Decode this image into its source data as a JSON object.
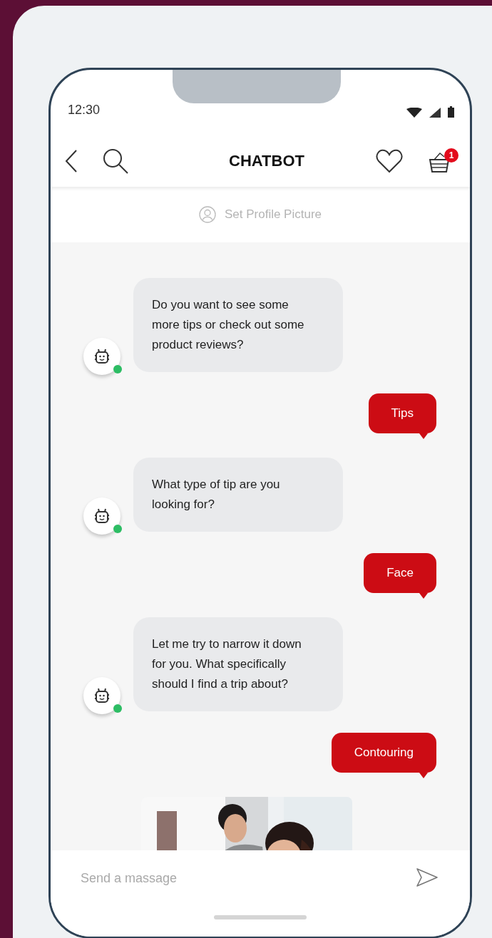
{
  "status_bar": {
    "time": "12:30"
  },
  "header": {
    "title": "CHATBOT",
    "cart_count": "1"
  },
  "profile": {
    "label": "Set Profile Picture"
  },
  "messages": [
    {
      "kind": "bot",
      "text": "Do you want to see some more tips or check out some product reviews?"
    },
    {
      "kind": "user",
      "text": "Tips"
    },
    {
      "kind": "bot",
      "text": "What type of tip are you looking for?"
    },
    {
      "kind": "user",
      "text": "Face"
    },
    {
      "kind": "bot",
      "text": "Let me try to narrow it down for you. What specifically should I find a trip about?"
    },
    {
      "kind": "user",
      "text": "Contouring"
    },
    {
      "kind": "picture"
    }
  ],
  "composer": {
    "placeholder": "Send a massage"
  }
}
